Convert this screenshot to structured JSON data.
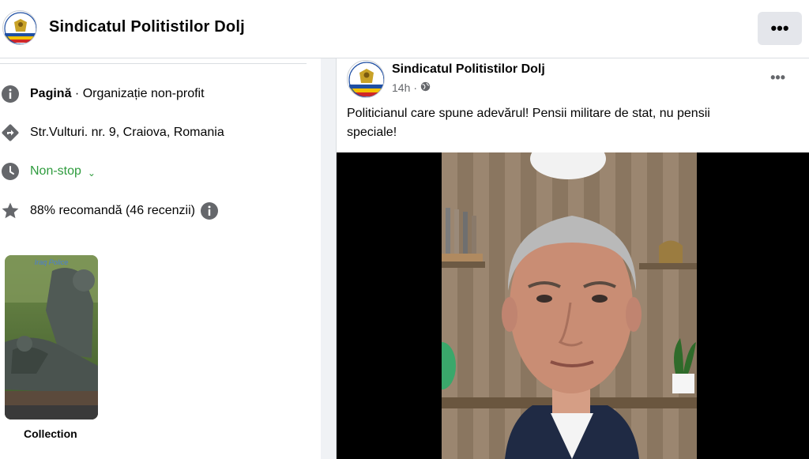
{
  "header": {
    "title": "Sindicatul Politistilor Dolj",
    "more_label": "•••"
  },
  "about": {
    "category_bold": "Pagină",
    "category_rest": " · Organizație non-profit",
    "address": "Str.Vulturi. nr. 9, Craiova, Romania",
    "hours": "Non-stop",
    "rating": "88% recomandă (46 recenzii)"
  },
  "collection": {
    "label": "Collection",
    "thumb_caption": "Iraq Police"
  },
  "post": {
    "author": "Sindicatul Politistilor Dolj",
    "time": "14h",
    "dot": "·",
    "more_label": "•••",
    "text": "Politicianul care spune adevărul! Pensii militare de stat, nu pensii speciale!"
  },
  "icons": {
    "info": "info-circle-icon",
    "directions": "directions-icon",
    "clock": "clock-icon",
    "star": "star-icon",
    "globe": "globe-icon",
    "chevron": "chevron-down-icon"
  },
  "colors": {
    "accent_green": "#2e9b3d",
    "icon_gray": "#65676b",
    "button_bg": "#e4e6eb"
  }
}
